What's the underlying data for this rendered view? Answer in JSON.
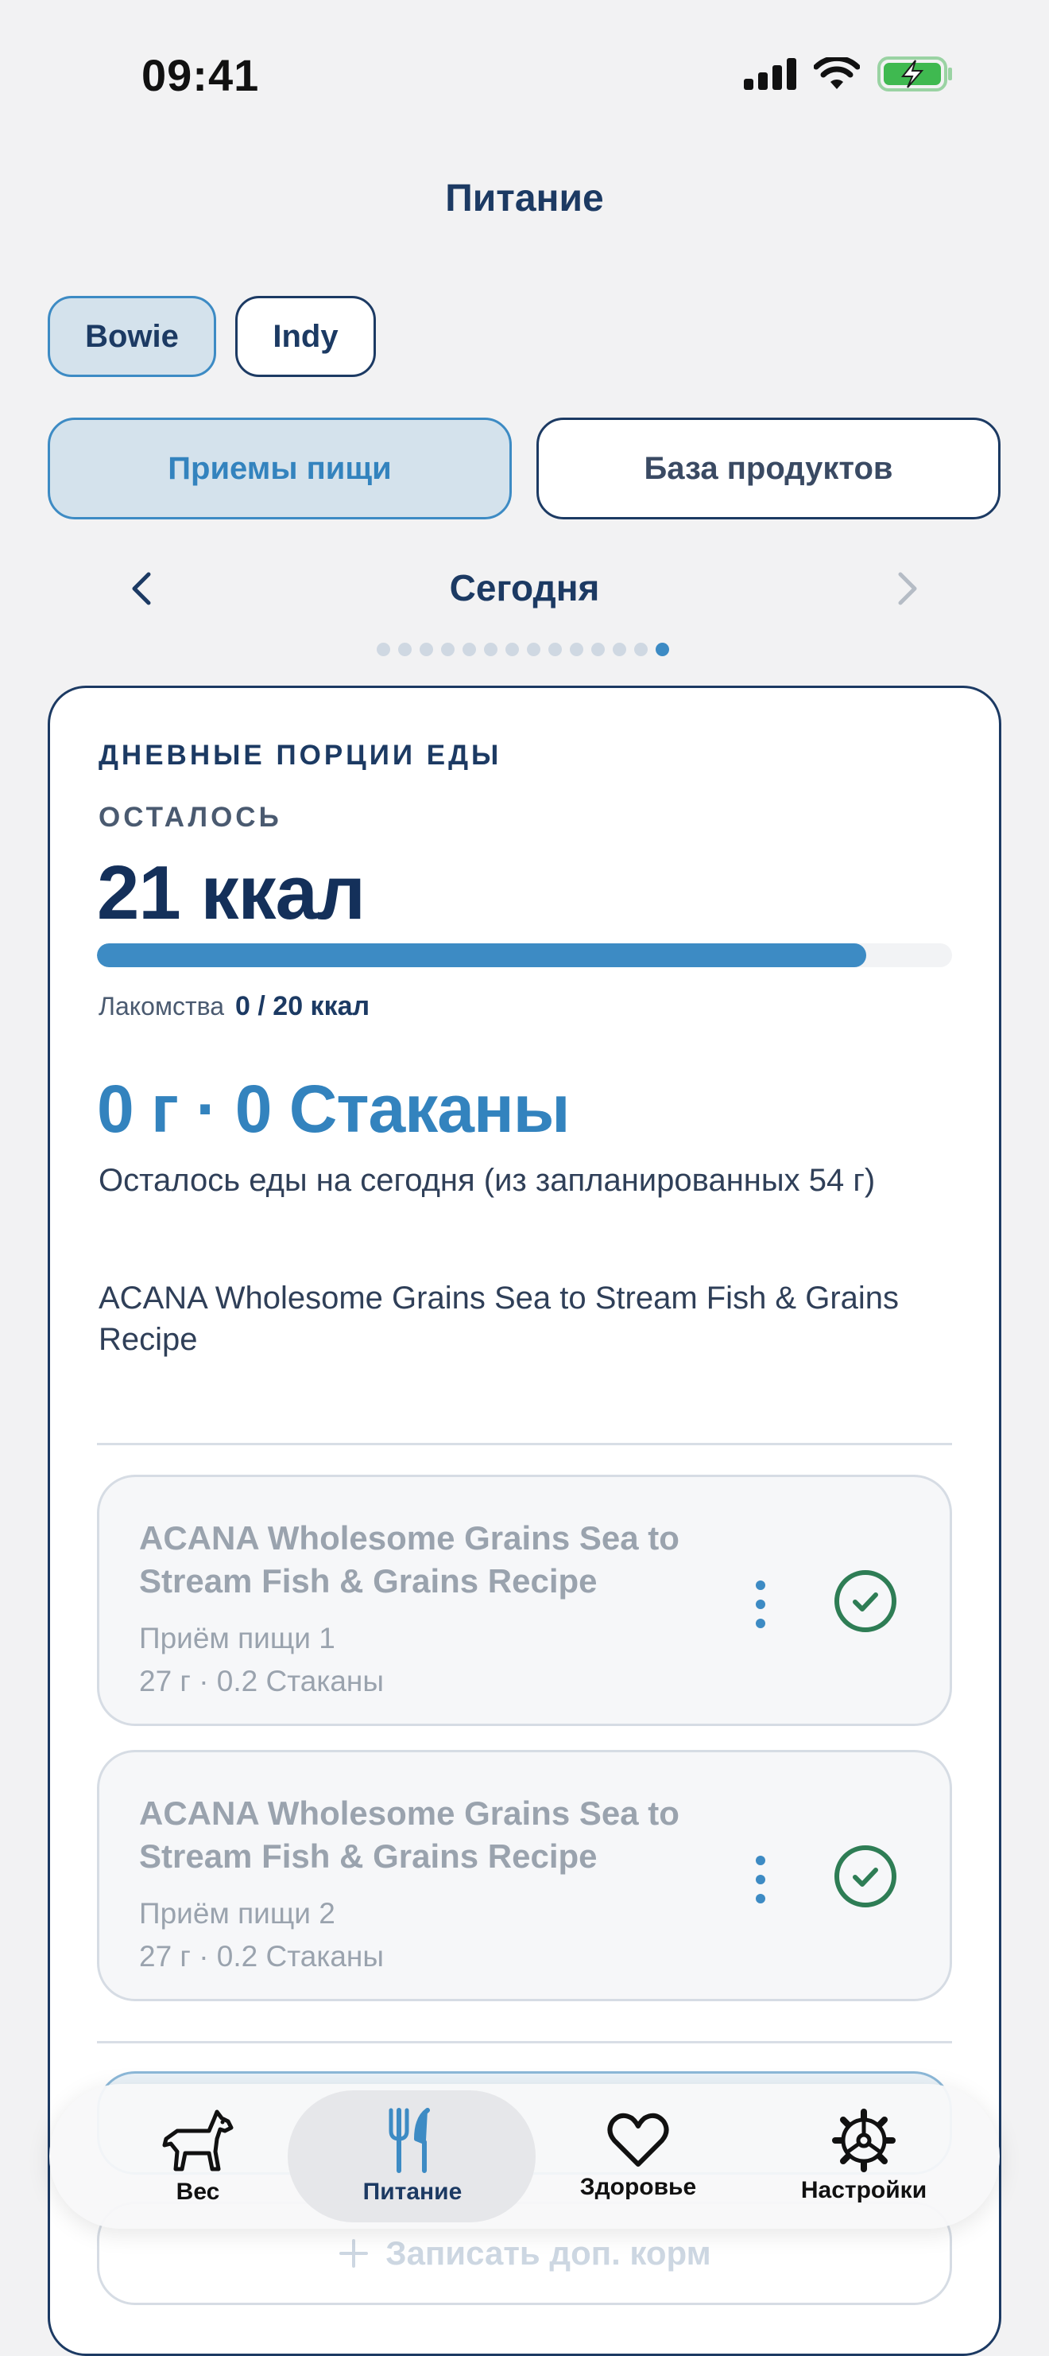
{
  "status": {
    "time": "09:41"
  },
  "header": {
    "title": "Питание"
  },
  "pets": [
    {
      "name": "Bowie",
      "active": true
    },
    {
      "name": "Indy",
      "active": false
    }
  ],
  "tabs": [
    {
      "label": "Приемы пищи",
      "active": true
    },
    {
      "label": "База продуктов",
      "active": false
    }
  ],
  "date_nav": {
    "label": "Сегодня",
    "page_count": 14,
    "current_page": 14
  },
  "daily": {
    "section_title": "ДНЕВНЫЕ ПОРЦИИ ЕДЫ",
    "remaining_label": "ОСТАЛОСЬ",
    "remaining_value": "21 ккал",
    "progress_fraction": 0.9,
    "treats_label": "Лакомства",
    "treats_value": "0 / 20 ккал",
    "amount": "0 г · 0 Стаканы",
    "amount_desc": "Осталось еды на сегодня (из запланированных 54 г)",
    "food_name": "ACANA Wholesome Grains Sea to Stream Fish & Grains Recipe"
  },
  "meals": [
    {
      "title": "ACANA Wholesome Grains Sea to Stream Fish & Grains Recipe",
      "meal": "Приём пищи 1",
      "amount": "27 г · 0.2 Стаканы",
      "done": true
    },
    {
      "title": "ACANA Wholesome Grains Sea to Stream Fish & Grains Recipe",
      "meal": "Приём пищи 2",
      "amount": "27 г · 0.2 Стаканы",
      "done": true
    }
  ],
  "actions": {
    "log_extra": "Записать доп. корм"
  },
  "tabbar": [
    {
      "label": "Вес",
      "icon": "dog-icon"
    },
    {
      "label": "Питание",
      "icon": "fork-knife-icon",
      "active": true
    },
    {
      "label": "Здоровье",
      "icon": "heart-icon"
    },
    {
      "label": "Настройки",
      "icon": "gear-icon"
    }
  ],
  "colors": {
    "accent": "#3d8bc4",
    "navy": "#1c3a63",
    "success": "#2e7d55"
  }
}
